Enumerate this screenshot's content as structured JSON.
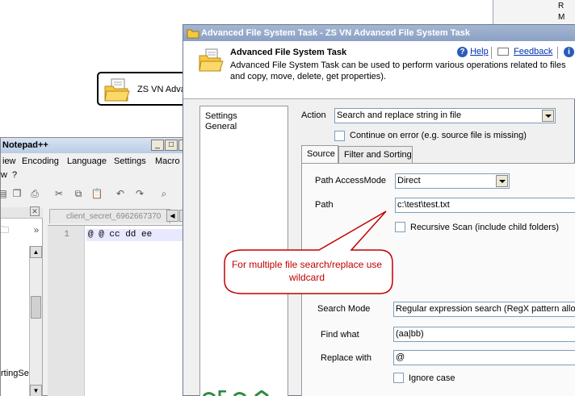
{
  "canvas": {
    "task_box_label": "ZS VN Adva",
    "right_panel": [
      "R",
      "M"
    ]
  },
  "notepad": {
    "title": "Notepad++",
    "menu": [
      "iew",
      "Encoding",
      "Language",
      "Settings",
      "Macro"
    ],
    "menu2": [
      "w",
      "?"
    ],
    "close_x": "X",
    "tab_label": "client_secret_6962667370",
    "line_number": "1",
    "line_text": "@ @ cc dd ee",
    "left_text": "rtingSe"
  },
  "dialog": {
    "title": "Advanced File System Task - ZS VN Advanced File System Task",
    "header_title": "Advanced File System Task",
    "header_desc": "Advanced File System Task can be used to perform various operations related to files and copy, move, delete, get properties).",
    "help": "Help",
    "feedback": "Feedback",
    "nav": [
      "Settings",
      "General"
    ],
    "action_label": "Action",
    "action_value": "Search and replace string in file",
    "continue_label": "Continue on error (e.g. source file is missing)",
    "tabs": [
      "Source",
      "Filter and Sorting"
    ],
    "path_access_label": "Path AccessMode",
    "path_access_value": "Direct",
    "path_label": "Path",
    "path_value": "c:\\test\\test.txt",
    "recursive_label": "Recursive Scan (include child folders)",
    "search_mode_label": "Search Mode",
    "search_mode_value": "Regular expression search (RegX pattern allow",
    "find_label": "Find what",
    "find_value": "(aa|bb)",
    "replace_label": "Replace with",
    "replace_value": "@",
    "ignore_case_label": "Ignore case"
  },
  "callout": {
    "text": "For multiple file search/replace use wildcard"
  },
  "colors": {
    "callout_text": "#c00000",
    "callout_border": "#c00000",
    "dialog_title_bg": "#8ba1c4",
    "link": "#0033aa"
  }
}
